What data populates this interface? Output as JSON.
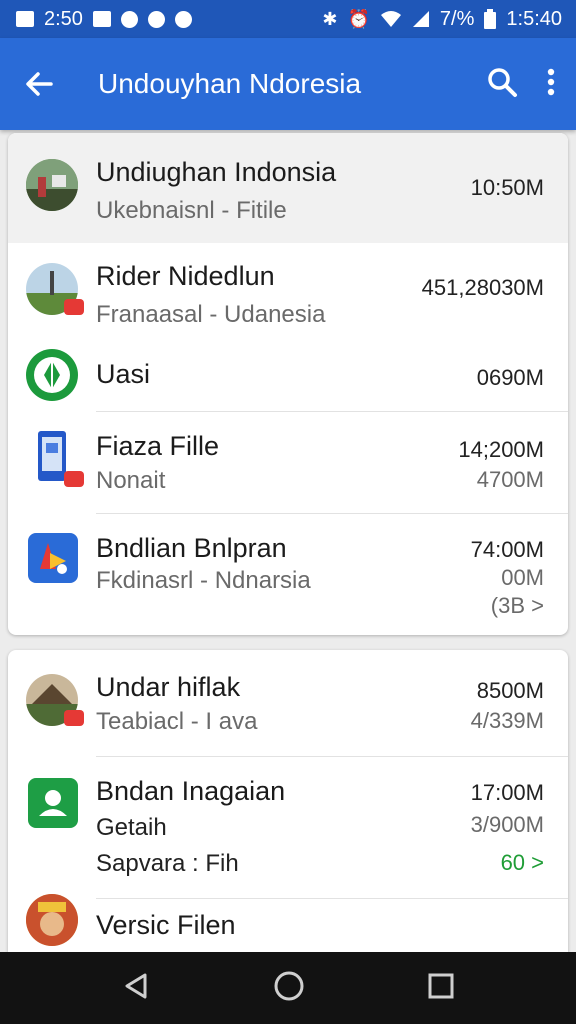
{
  "status_bar": {
    "time_left": "2:50",
    "battery_percent": "7/%",
    "clock": "1:5:40",
    "icons": [
      "bluetooth-icon",
      "alarm-icon",
      "wifi-icon",
      "signal-icon",
      "battery-icon"
    ]
  },
  "app_bar": {
    "title": "Undouyhan Ndoresia",
    "icons": [
      "back-arrow-icon",
      "search-icon",
      "more-vert-icon"
    ]
  },
  "colors": {
    "status_bar": "#1f57b8",
    "app_bar": "#2a6bd7",
    "accent_green": "#1f9d36",
    "badge_red": "#e53935"
  },
  "card1": {
    "items": [
      {
        "title": "Undiughan Indonsia",
        "subtitle": "Ukebnaisnl - Fitile",
        "size": "10:50M"
      },
      {
        "title": "Rider Nidedlun",
        "subtitle": "Franaasal - Udanesia",
        "size": "451,28030M"
      },
      {
        "title": "Uasi",
        "size": "0690M"
      },
      {
        "title": "Fiaza Fille",
        "subtitle": "Nonait",
        "size": "14;200M",
        "size2": "4700M"
      },
      {
        "title": "Bndlian Bnlpran",
        "subtitle": "Fkdinasrl - Ndnarsia",
        "size": "74:00M",
        "size2": "00M",
        "link": "(3B >"
      }
    ]
  },
  "card2": {
    "items": [
      {
        "title": "Undar hiflak",
        "subtitle": "Teabiacl - I ava",
        "size": "8500M",
        "size2": "4/339M"
      },
      {
        "title": "Bndan Inagaian",
        "subtitle": "Getaih",
        "extra": "Sapvara : Fih",
        "size": "17:00M",
        "size2": "3/900M",
        "link": "60 >"
      },
      {
        "title": "Versic Filen"
      }
    ]
  },
  "nav_bar": {
    "icons": [
      "back-triangle-icon",
      "home-circle-icon",
      "recents-square-icon"
    ]
  }
}
